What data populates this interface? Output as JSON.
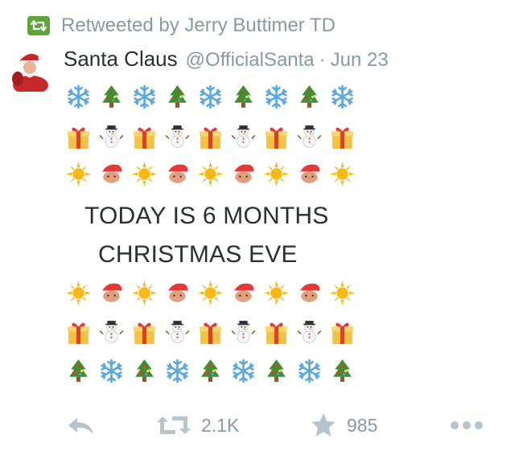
{
  "retweet_context": {
    "text": "Retweeted by Jerry Buttimer TD",
    "icon": "retweet-icon",
    "badge_color": "#5ea53b"
  },
  "tweet": {
    "fullname": "Santa Claus",
    "username": "@OfficialSanta",
    "separator": "·",
    "timestamp": "Jun 23",
    "avatar": "santa-avatar",
    "text_line_1": "TODAY IS 6 MONTHS",
    "text_line_2": "CHRISTMAS EVE",
    "emoji_rows": [
      [
        "snowflake",
        "christmas-tree",
        "snowflake",
        "christmas-tree",
        "snowflake",
        "christmas-tree",
        "snowflake",
        "christmas-tree",
        "snowflake"
      ],
      [
        "gift",
        "snowman",
        "gift",
        "snowman",
        "gift",
        "snowman",
        "gift",
        "snowman",
        "gift"
      ],
      [
        "sun",
        "santa",
        "sun",
        "santa",
        "sun",
        "santa",
        "sun",
        "santa",
        "sun"
      ],
      [
        "sun",
        "santa",
        "sun",
        "santa",
        "sun",
        "santa",
        "sun",
        "santa",
        "sun"
      ],
      [
        "gift",
        "snowman",
        "gift",
        "snowman",
        "gift",
        "snowman",
        "gift",
        "snowman",
        "gift"
      ],
      [
        "christmas-tree",
        "snowflake",
        "christmas-tree",
        "snowflake",
        "christmas-tree",
        "snowflake",
        "christmas-tree",
        "snowflake",
        "christmas-tree"
      ]
    ]
  },
  "actions": {
    "reply_icon": "reply-icon",
    "retweet_icon": "retweet-icon",
    "retweet_count": "2.1K",
    "favorite_icon": "star-icon",
    "favorite_count": "985",
    "more_icon": "more-icon"
  },
  "colors": {
    "text": "#292f33",
    "muted": "#8899a6",
    "action_icons": "#b8c3cc"
  }
}
